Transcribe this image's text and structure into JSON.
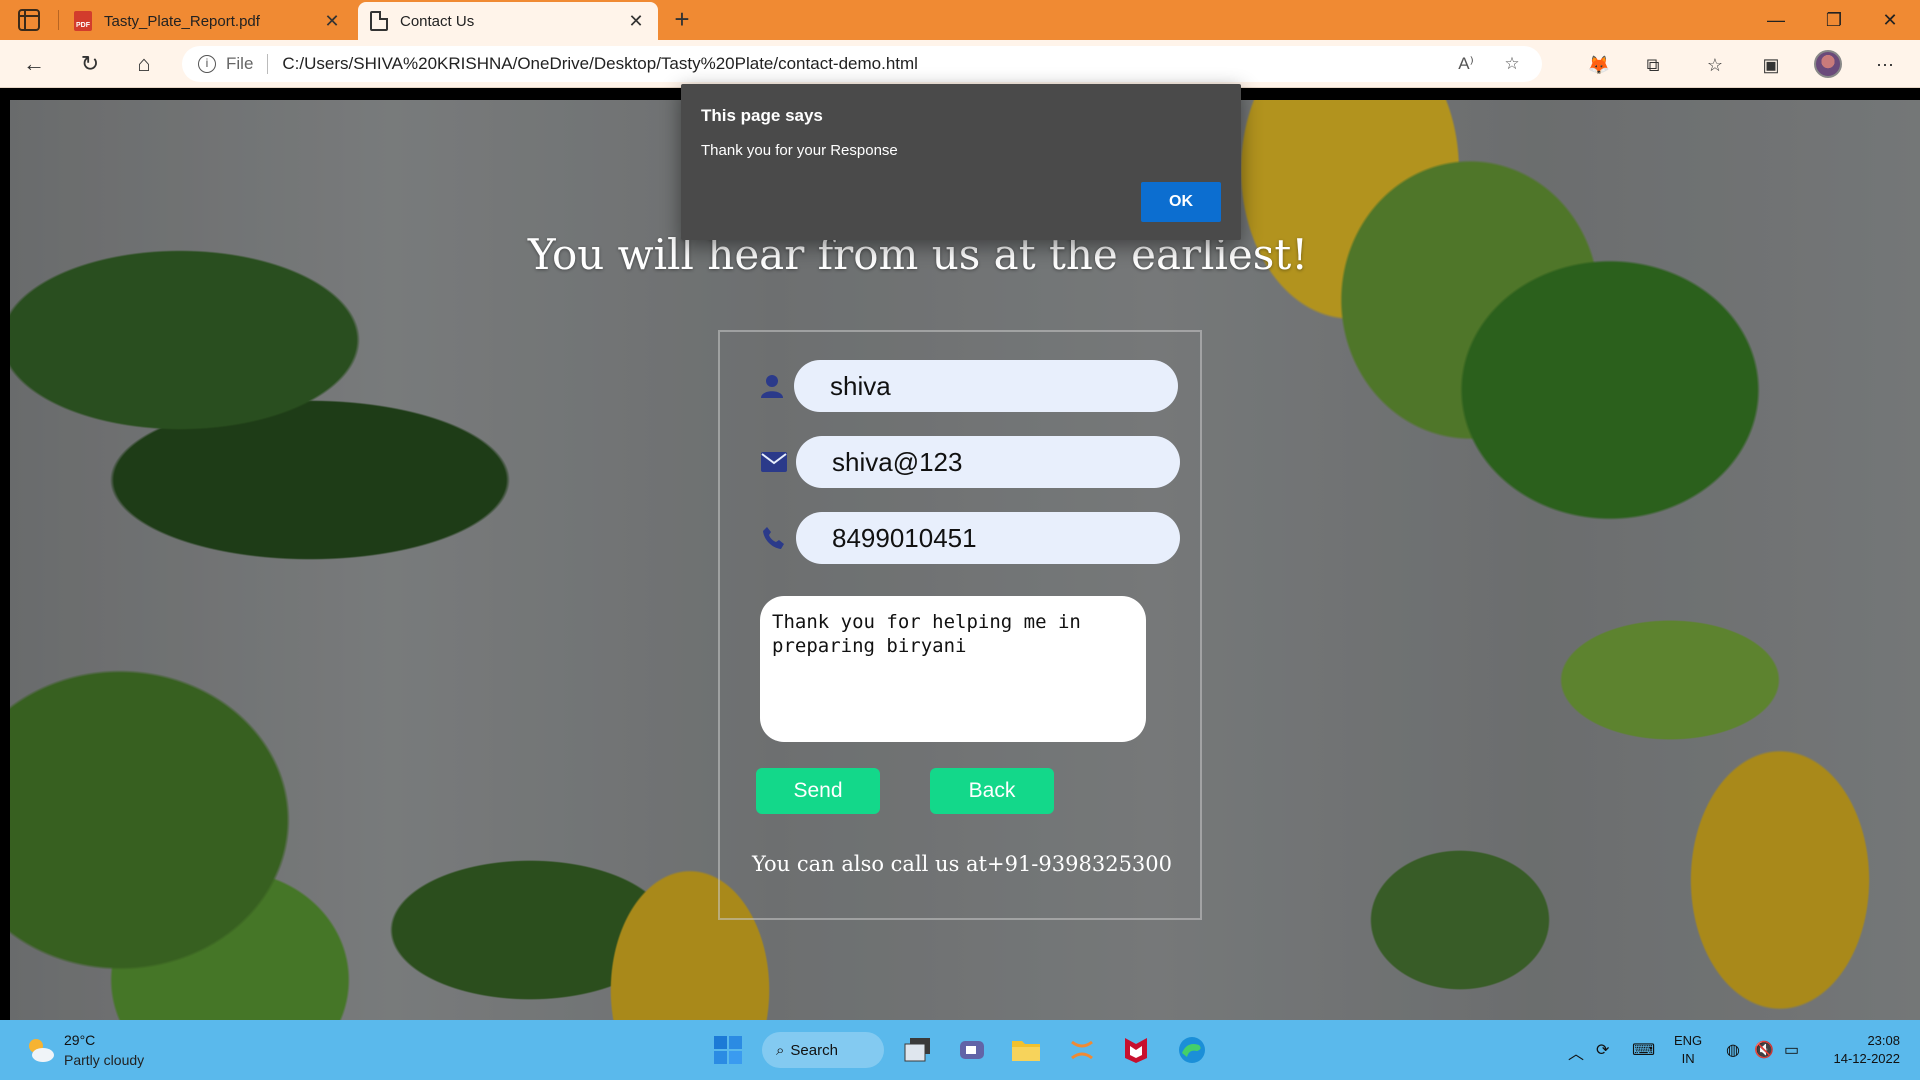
{
  "browser": {
    "tabs": [
      {
        "title": "Tasty_Plate_Report.pdf",
        "favicon": "pdf-icon",
        "active": false
      },
      {
        "title": "Contact Us",
        "favicon": "page-icon",
        "active": true
      }
    ],
    "address": {
      "scheme_label": "File",
      "url": "C:/Users/SHIVA%20KRISHNA/OneDrive/Desktop/Tasty%20Plate/contact-demo.html"
    },
    "accent_color": "#f08a33"
  },
  "page": {
    "heading": "You will hear from us at the earliest!",
    "form": {
      "name_value": "shiva",
      "email_value": "shiva@123",
      "phone_value": "8499010451",
      "message_value": "Thank you for helping me in preparing biryani",
      "send_label": "Send",
      "back_label": "Back"
    },
    "call_text": "You can also call us at+91-9398325300",
    "button_color": "#13d88a"
  },
  "dialog": {
    "title": "This page says",
    "message": "Thank you for your Response",
    "ok_label": "OK"
  },
  "taskbar": {
    "weather_temp": "29°C",
    "weather_desc": "Partly cloudy",
    "search_label": "Search",
    "lang_top": "ENG",
    "lang_bottom": "IN",
    "time": "23:08",
    "date": "14-12-2022"
  }
}
